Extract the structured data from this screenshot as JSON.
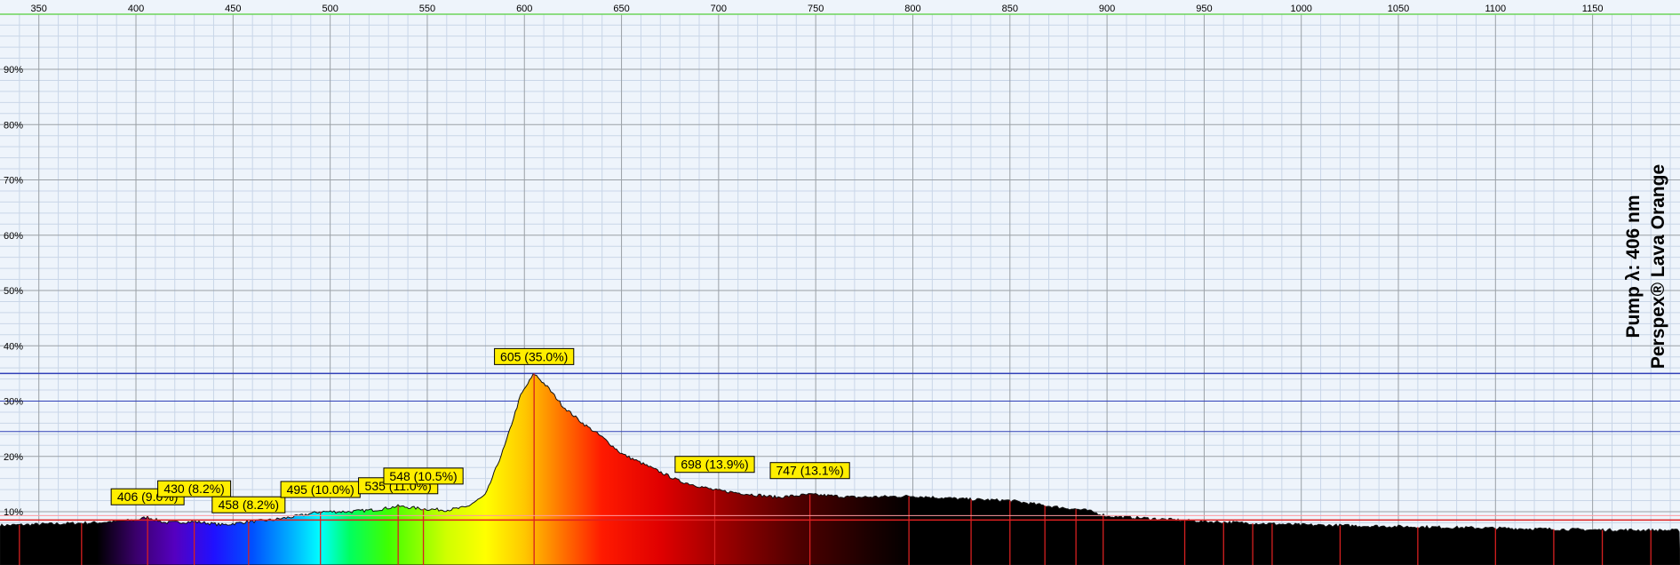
{
  "chart_data": {
    "type": "area",
    "side_label_line1": "Pump λ: 406 nm",
    "side_label_line2": "Perspex® Lava Orange",
    "xlim": [
      330,
      1195
    ],
    "ylim": [
      0,
      100
    ],
    "x_ticks": [
      350,
      400,
      450,
      500,
      550,
      600,
      650,
      700,
      750,
      800,
      850,
      900,
      950,
      1000,
      1050,
      1100,
      1150
    ],
    "y_ticks": [
      10,
      20,
      30,
      40,
      50,
      60,
      70,
      80,
      90
    ],
    "y_tick_labels": [
      "10%",
      "20%",
      "30%",
      "40%",
      "50%",
      "60%",
      "70%",
      "80%",
      "90%"
    ],
    "reference_lines_y": [
      35.0,
      30.0,
      24.5
    ],
    "baseline_y": 8.5,
    "spectrum": {
      "x": [
        330,
        360,
        380,
        400,
        406,
        415,
        430,
        445,
        458,
        470,
        485,
        495,
        510,
        525,
        535,
        548,
        560,
        570,
        580,
        590,
        598,
        605,
        612,
        620,
        630,
        640,
        650,
        665,
        680,
        698,
        715,
        730,
        747,
        770,
        800,
        830,
        850,
        870,
        890,
        900,
        950,
        1000,
        1050,
        1100,
        1150,
        1195
      ],
      "y": [
        7.5,
        7.8,
        8.0,
        8.5,
        9.0,
        8.0,
        8.2,
        7.6,
        8.2,
        8.5,
        9.3,
        10.0,
        10.0,
        10.4,
        11.0,
        10.5,
        10.3,
        10.8,
        13.0,
        22.0,
        31.0,
        35.0,
        32.5,
        29.0,
        26.0,
        23.5,
        20.5,
        18.0,
        15.5,
        13.9,
        13.2,
        12.6,
        13.1,
        12.6,
        12.8,
        12.2,
        12.0,
        11.0,
        10.2,
        9.2,
        8.2,
        7.6,
        7.3,
        7.0,
        6.7,
        6.6
      ]
    },
    "peaks": [
      {
        "x": 406,
        "y": 9.0,
        "label": "406 (9.0%)"
      },
      {
        "x": 430,
        "y": 8.2,
        "label": "430 (8.2%)"
      },
      {
        "x": 458,
        "y": 8.2,
        "label": "458 (8.2%)"
      },
      {
        "x": 495,
        "y": 10.0,
        "label": "495 (10.0%)"
      },
      {
        "x": 535,
        "y": 11.0,
        "label": "535 (11.0%)"
      },
      {
        "x": 548,
        "y": 10.5,
        "label": "548 (10.5%)"
      },
      {
        "x": 605,
        "y": 35.0,
        "label": "605 (35.0%)"
      },
      {
        "x": 698,
        "y": 13.9,
        "label": "698 (13.9%)"
      },
      {
        "x": 747,
        "y": 13.1,
        "label": "747 (13.1%)"
      }
    ],
    "marker_lines_x": [
      340,
      372,
      406,
      430,
      458,
      495,
      535,
      548,
      605,
      698,
      747,
      798,
      830,
      850,
      868,
      884,
      898,
      940,
      960,
      975,
      985,
      1020,
      1060,
      1100,
      1130,
      1155,
      1180
    ],
    "colors": {
      "background": "#eef4fb",
      "grid_major": "#9aa0a6",
      "grid_minor": "#c9d6e8",
      "reference_line": "#3140b8",
      "marker_line": "#d62020",
      "baseline": "#e02020",
      "label_fill": "#ffee00",
      "axis_top": "#6dd35b"
    }
  }
}
